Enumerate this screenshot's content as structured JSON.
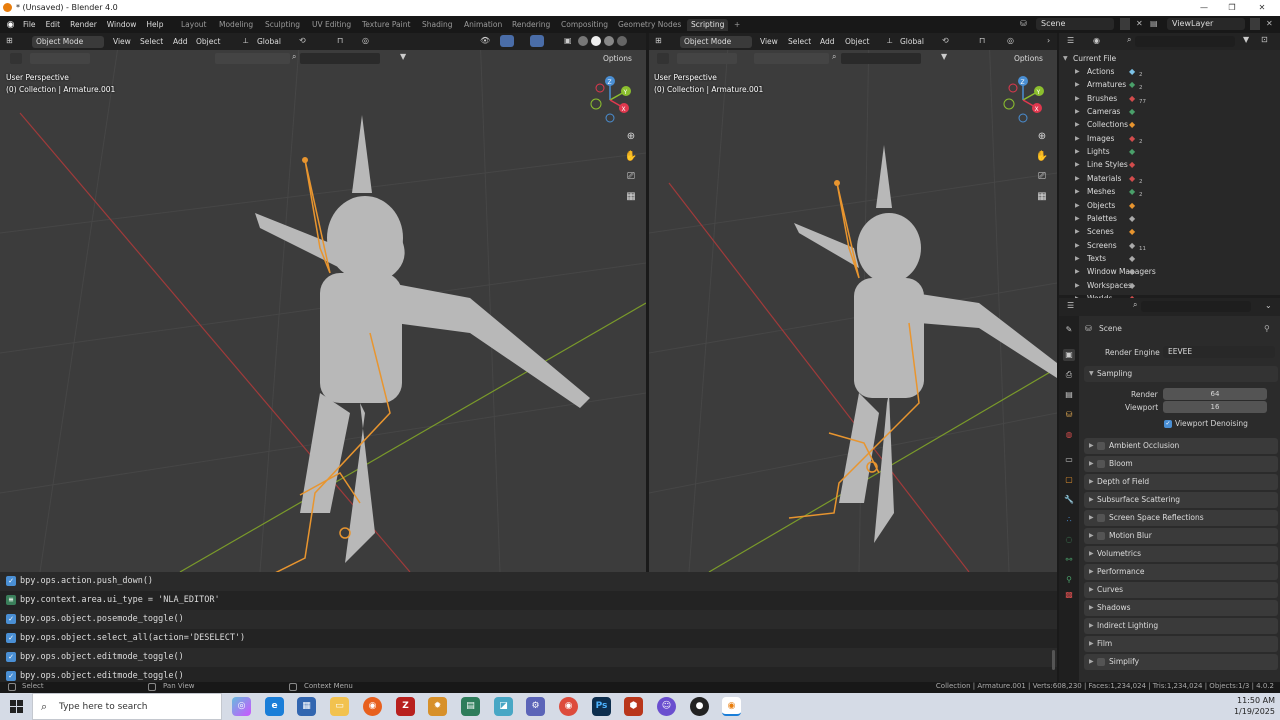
{
  "titlebar": {
    "title": "* (Unsaved) - Blender 4.0"
  },
  "topbar": {
    "menus": [
      "File",
      "Edit",
      "Render",
      "Window",
      "Help"
    ],
    "workspaces": [
      "Layout",
      "Modeling",
      "Sculpting",
      "UV Editing",
      "Texture Paint",
      "Shading",
      "Animation",
      "Rendering",
      "Compositing",
      "Geometry Nodes",
      "Scripting"
    ],
    "active_workspace": "Scripting",
    "plus": "+",
    "scene": "Scene",
    "view_layer": "ViewLayer"
  },
  "viewport_left": {
    "mode": "Object Mode",
    "menus": [
      "View",
      "Select",
      "Add",
      "Object"
    ],
    "orientation": "Global",
    "options": "Options",
    "perspective": "User Perspective",
    "collection": "(0) Collection | Armature.001"
  },
  "viewport_right": {
    "mode": "Object Mode",
    "menus": [
      "View",
      "Select",
      "Add",
      "Object"
    ],
    "orientation": "Global",
    "options": "Options",
    "perspective": "User Perspective",
    "collection": "(0) Collection | Armature.001"
  },
  "gizmo": {
    "x": "X",
    "y": "Y",
    "z": "Z"
  },
  "console": {
    "lines": [
      "bpy.ops.action.push_down()",
      "bpy.context.area.ui_type = 'NLA_EDITOR'",
      "bpy.ops.object.posemode_toggle()",
      "bpy.ops.object.select_all(action='DESELECT')",
      "bpy.ops.object.editmode_toggle()",
      "bpy.ops.object.editmode_toggle()"
    ]
  },
  "outliner": {
    "root": "Current File",
    "items": [
      {
        "label": "Actions",
        "count": "2"
      },
      {
        "label": "Armatures",
        "count": "2"
      },
      {
        "label": "Brushes",
        "count": "77"
      },
      {
        "label": "Cameras",
        "count": ""
      },
      {
        "label": "Collections",
        "count": ""
      },
      {
        "label": "Images",
        "count": "2"
      },
      {
        "label": "Lights",
        "count": ""
      },
      {
        "label": "Line Styles",
        "count": ""
      },
      {
        "label": "Materials",
        "count": "2"
      },
      {
        "label": "Meshes",
        "count": "2"
      },
      {
        "label": "Objects",
        "count": ""
      },
      {
        "label": "Palettes",
        "count": ""
      },
      {
        "label": "Scenes",
        "count": ""
      },
      {
        "label": "Screens",
        "count": "11"
      },
      {
        "label": "Texts",
        "count": ""
      },
      {
        "label": "Window Managers",
        "count": ""
      },
      {
        "label": "Workspaces",
        "count": ""
      },
      {
        "label": "Worlds",
        "count": ""
      }
    ]
  },
  "properties": {
    "context": "Scene",
    "render_engine_label": "Render Engine",
    "render_engine": "EEVEE",
    "sampling": "Sampling",
    "render_label": "Render",
    "render_value": "64",
    "viewport_label": "Viewport",
    "viewport_value": "16",
    "denoise": "Viewport Denoising",
    "panels": [
      {
        "label": "Ambient Occlusion",
        "checkbox": true
      },
      {
        "label": "Bloom",
        "checkbox": true
      },
      {
        "label": "Depth of Field",
        "checkbox": false
      },
      {
        "label": "Subsurface Scattering",
        "checkbox": false
      },
      {
        "label": "Screen Space Reflections",
        "checkbox": true
      },
      {
        "label": "Motion Blur",
        "checkbox": true
      },
      {
        "label": "Volumetrics",
        "checkbox": false
      },
      {
        "label": "Performance",
        "checkbox": false
      },
      {
        "label": "Curves",
        "checkbox": false
      },
      {
        "label": "Shadows",
        "checkbox": false
      },
      {
        "label": "Indirect Lighting",
        "checkbox": false
      },
      {
        "label": "Film",
        "checkbox": false
      },
      {
        "label": "Simplify",
        "checkbox": true
      }
    ]
  },
  "status": {
    "select": "Select",
    "pan": "Pan View",
    "context": "Context Menu",
    "stats": "Collection | Armature.001 | Verts:608,230 | Faces:1,234,024 | Tris:1,234,024 | Objects:1/3 | 4.0.2"
  },
  "taskbar": {
    "search_placeholder": "Type here to search",
    "time": "11:50 AM",
    "date": "1/19/2025"
  },
  "colors": {
    "accent": "#4a8fd4",
    "armature": "#e8952f",
    "background": "#3c3c3c"
  }
}
